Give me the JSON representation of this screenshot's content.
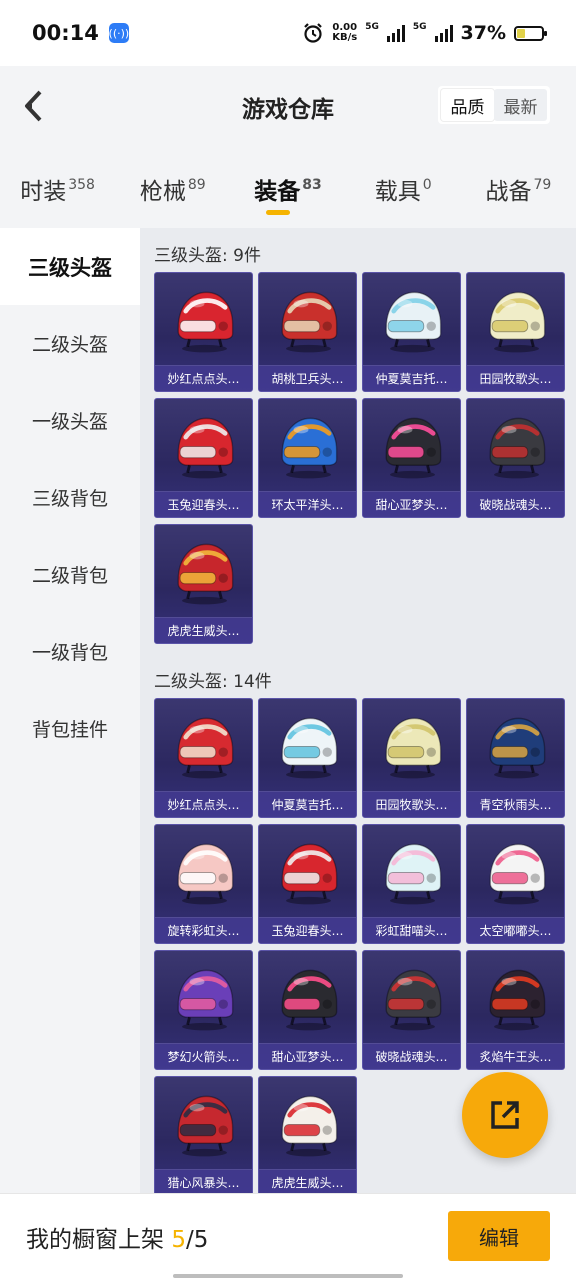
{
  "status": {
    "time": "00:14",
    "net_speed": "0.00",
    "net_unit": "KB/s",
    "sim1": "5G",
    "sim2": "5G",
    "battery": "37%"
  },
  "header": {
    "title": "游戏仓库",
    "sort_options": [
      "品质",
      "最新"
    ]
  },
  "tabs": [
    {
      "label": "时装",
      "count": "358"
    },
    {
      "label": "枪械",
      "count": "89"
    },
    {
      "label": "装备",
      "count": "83"
    },
    {
      "label": "载具",
      "count": "0"
    },
    {
      "label": "战备",
      "count": "79"
    }
  ],
  "sidebar": [
    {
      "label": "三级头盔"
    },
    {
      "label": "二级头盔"
    },
    {
      "label": "一级头盔"
    },
    {
      "label": "三级背包"
    },
    {
      "label": "二级背包"
    },
    {
      "label": "一级背包"
    },
    {
      "label": "背包挂件"
    }
  ],
  "sections": [
    {
      "title": "三级头盔: 9件",
      "items": [
        {
          "name": "妙红点点头…",
          "color": "#d9252f",
          "accent": "#ffffff"
        },
        {
          "name": "胡桃卫兵头…",
          "color": "#c9302c",
          "accent": "#e8d8b8"
        },
        {
          "name": "仲夏莫吉托…",
          "color": "#e8f2f6",
          "accent": "#7fd0e8"
        },
        {
          "name": "田园牧歌头…",
          "color": "#f0edc8",
          "accent": "#d9c96a"
        },
        {
          "name": "玉兔迎春头…",
          "color": "#d8262e",
          "accent": "#f0f0f0"
        },
        {
          "name": "环太平洋头…",
          "color": "#2a6fd6",
          "accent": "#f39c1d"
        },
        {
          "name": "甜心亚梦头…",
          "color": "#2b2b33",
          "accent": "#ff4f9c"
        },
        {
          "name": "破晓战魂头…",
          "color": "#3a3a40",
          "accent": "#c23030"
        },
        {
          "name": "虎虎生威头…",
          "color": "#c7262c",
          "accent": "#f2b93b"
        }
      ]
    },
    {
      "title": "二级头盔: 14件",
      "items": [
        {
          "name": "妙红点点头…",
          "color": "#d72a30",
          "accent": "#f3e3d0"
        },
        {
          "name": "仲夏莫吉托…",
          "color": "#eef5f8",
          "accent": "#5fc3df"
        },
        {
          "name": "田园牧歌头…",
          "color": "#ece8b8",
          "accent": "#d2c46a"
        },
        {
          "name": "青空秋雨头…",
          "color": "#1f3d7a",
          "accent": "#d9a441"
        },
        {
          "name": "旋转彩虹头…",
          "color": "#f6c8c4",
          "accent": "#ffffff"
        },
        {
          "name": "玉兔迎春头…",
          "color": "#d8262e",
          "accent": "#f0f0f0"
        },
        {
          "name": "彩虹甜喵头…",
          "color": "#dff3f6",
          "accent": "#f6b6d6"
        },
        {
          "name": "太空嘟嘟头…",
          "color": "#f4f4f4",
          "accent": "#ee5a8a"
        },
        {
          "name": "梦幻火箭头…",
          "color": "#6a3fb8",
          "accent": "#e85da0"
        },
        {
          "name": "甜心亚梦头…",
          "color": "#2a2a30",
          "accent": "#ff4f8c"
        },
        {
          "name": "破晓战魂头…",
          "color": "#3b3b42",
          "accent": "#d23434"
        },
        {
          "name": "炙焰牛王头…",
          "color": "#2c2230",
          "accent": "#e33b21"
        },
        {
          "name": "猎心风暴头…",
          "color": "#c6282f",
          "accent": "#2c2c44"
        },
        {
          "name": "虎虎生威头…",
          "color": "#f4f0ea",
          "accent": "#d9262c"
        }
      ]
    }
  ],
  "bottom": {
    "label": "我的橱窗上架",
    "current": "5",
    "sep": "/",
    "total": "5",
    "edit": "编辑"
  },
  "colors": {
    "accent": "#f7a90a",
    "card_bg": "#2c2860"
  }
}
